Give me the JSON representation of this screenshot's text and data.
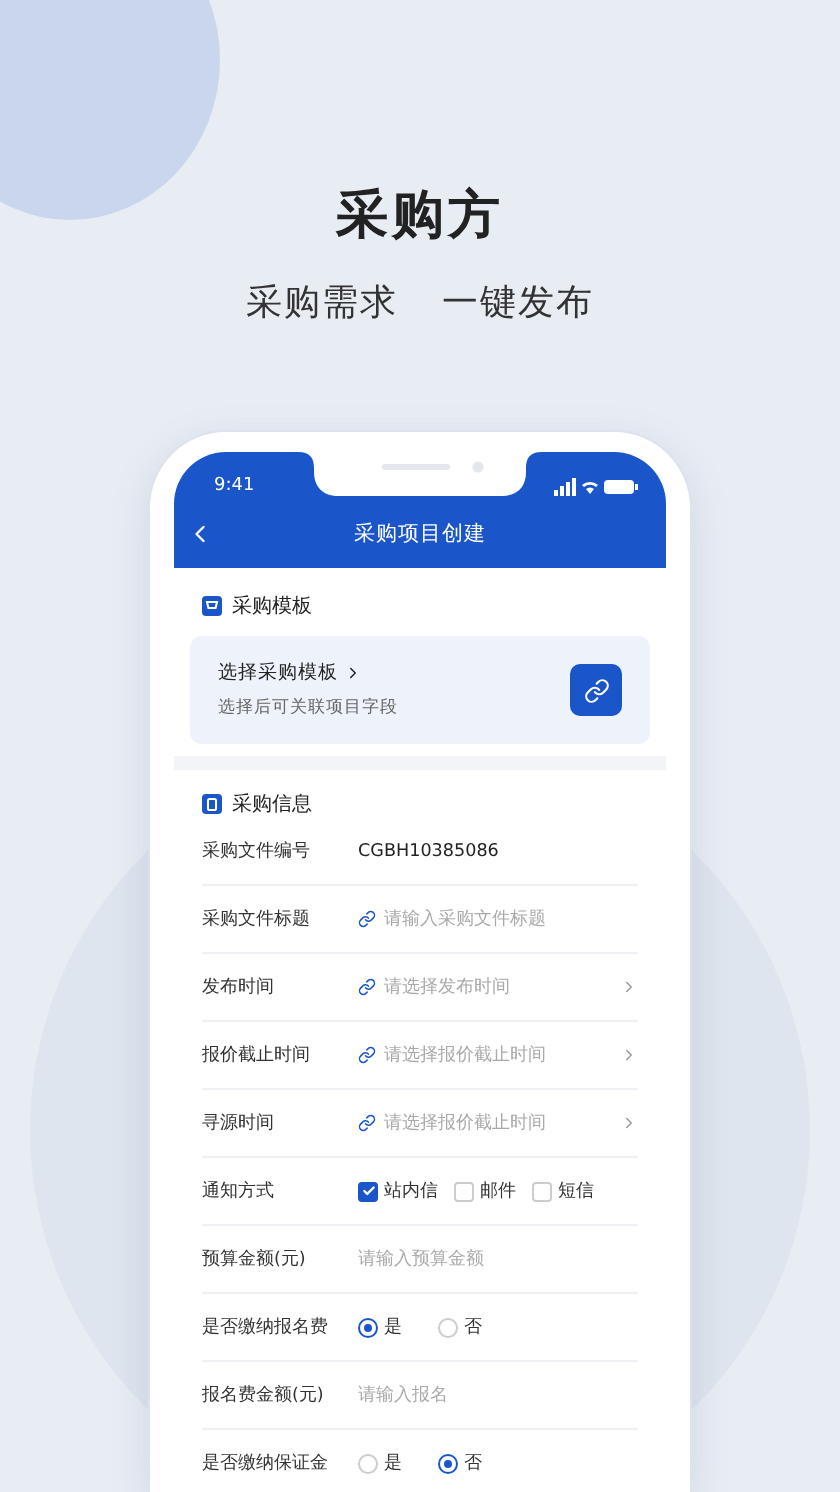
{
  "hero": {
    "title": "采购方",
    "subtitle": [
      "采购需求",
      "一键发布"
    ]
  },
  "status_bar": {
    "time": "9:41"
  },
  "nav": {
    "title": "采购项目创建"
  },
  "template_section": {
    "heading": "采购模板",
    "card": {
      "title": "选择采购模板",
      "hint": "选择后可关联项目字段"
    }
  },
  "info_section": {
    "heading": "采购信息",
    "rows": [
      {
        "kind": "text",
        "label": "采购文件编号",
        "value": "CGBH10385086"
      },
      {
        "kind": "input",
        "label": "采购文件标题",
        "placeholder": "请输入采购文件标题",
        "link": true,
        "chevron": false
      },
      {
        "kind": "input",
        "label": "发布时间",
        "placeholder": "请选择发布时间",
        "link": true,
        "chevron": true
      },
      {
        "kind": "input",
        "label": "报价截止时间",
        "placeholder": "请选择报价截止时间",
        "link": true,
        "chevron": true
      },
      {
        "kind": "input",
        "label": "寻源时间",
        "placeholder": "请选择报价截止时间",
        "link": true,
        "chevron": true
      },
      {
        "kind": "checks",
        "label": "通知方式",
        "options": [
          {
            "label": "站内信",
            "checked": true
          },
          {
            "label": "邮件",
            "checked": false
          },
          {
            "label": "短信",
            "checked": false
          }
        ]
      },
      {
        "kind": "input",
        "label": "预算金额(元)",
        "placeholder": "请输入预算金额",
        "link": false,
        "chevron": false
      },
      {
        "kind": "radios",
        "label": "是否缴纳报名费",
        "options": [
          {
            "label": "是",
            "selected": true
          },
          {
            "label": "否",
            "selected": false
          }
        ]
      },
      {
        "kind": "input",
        "label": "报名费金额(元)",
        "placeholder": "请输入报名",
        "link": false,
        "chevron": false
      },
      {
        "kind": "radios",
        "label": "是否缴纳保证金",
        "options": [
          {
            "label": "是",
            "selected": false
          },
          {
            "label": "否",
            "selected": true
          }
        ]
      }
    ]
  }
}
